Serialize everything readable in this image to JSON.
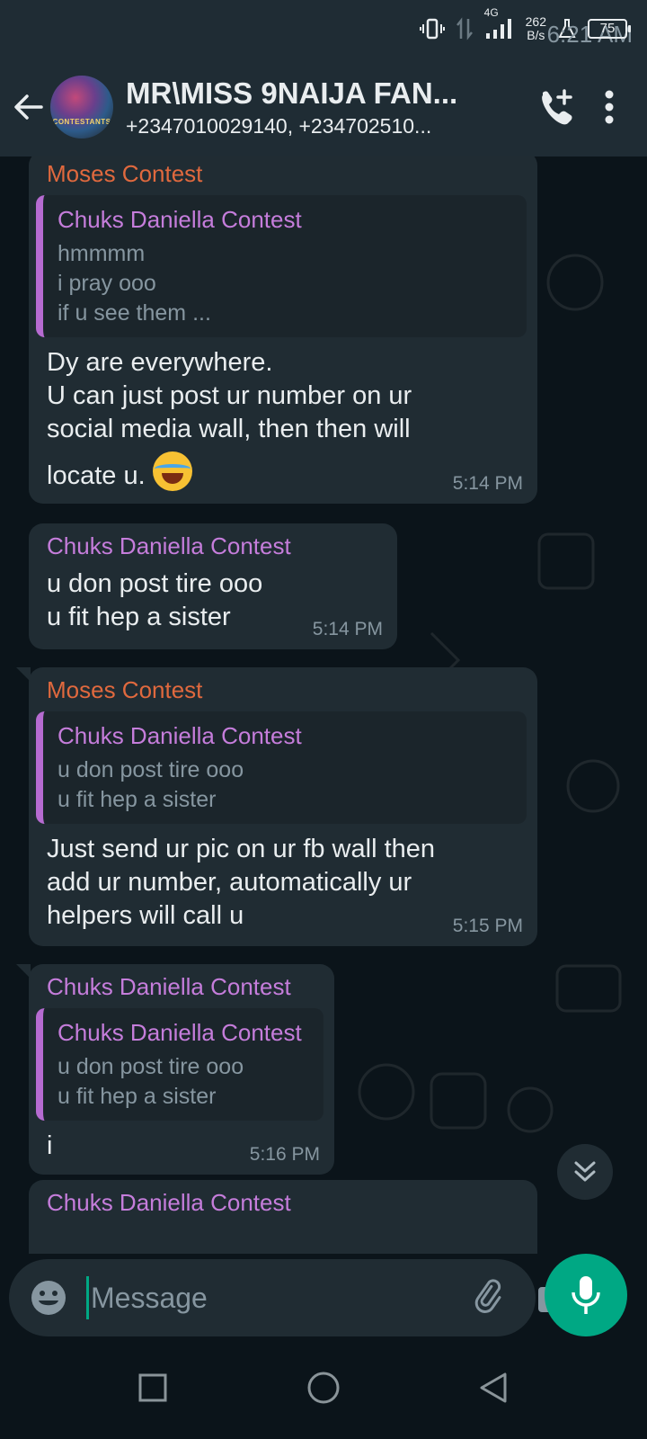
{
  "status_bar": {
    "time": "6:21 AM",
    "network_type": "4G",
    "net_speed_value": "262",
    "net_speed_unit": "B/s",
    "battery": "75"
  },
  "header": {
    "title": "MR\\MISS 9NAIJA FAN...",
    "subtitle": "+2347010029140, +234702510...",
    "avatar_text": "CONTESTANTS"
  },
  "messages": [
    {
      "sender": "Moses Contest",
      "quote": {
        "name": "Chuks Daniella Contest",
        "lines": [
          "hmmmm",
          "i pray ooo",
          "if u see them ..."
        ]
      },
      "lines": [
        "Dy are everywhere.",
        "U can just post ur number on ur",
        "social media wall, then then will",
        "locate u."
      ],
      "time": "5:14 PM"
    },
    {
      "sender": "Chuks Daniella Contest",
      "lines": [
        "u don post tire ooo",
        "u fit hep a sister"
      ],
      "time": "5:14 PM"
    },
    {
      "sender": "Moses Contest",
      "quote": {
        "name": "Chuks Daniella Contest",
        "lines": [
          "u don post tire ooo",
          "u fit hep a sister"
        ]
      },
      "lines": [
        "Just send ur pic on ur fb wall then",
        "add ur number, automatically ur",
        "helpers will call u"
      ],
      "time": "5:15 PM"
    },
    {
      "sender": "Chuks Daniella Contest",
      "quote": {
        "name": "Chuks Daniella Contest",
        "lines": [
          "u don post tire ooo",
          "u fit hep a sister"
        ]
      },
      "lines": [
        "i"
      ],
      "time": "5:16 PM"
    },
    {
      "sender": "Chuks Daniella Contest"
    }
  ],
  "input": {
    "placeholder": "Message"
  },
  "colors": {
    "accent": "#00a884",
    "bubble": "#202c33",
    "sender_orange": "#e0693e",
    "sender_purple": "#c57ddb"
  }
}
